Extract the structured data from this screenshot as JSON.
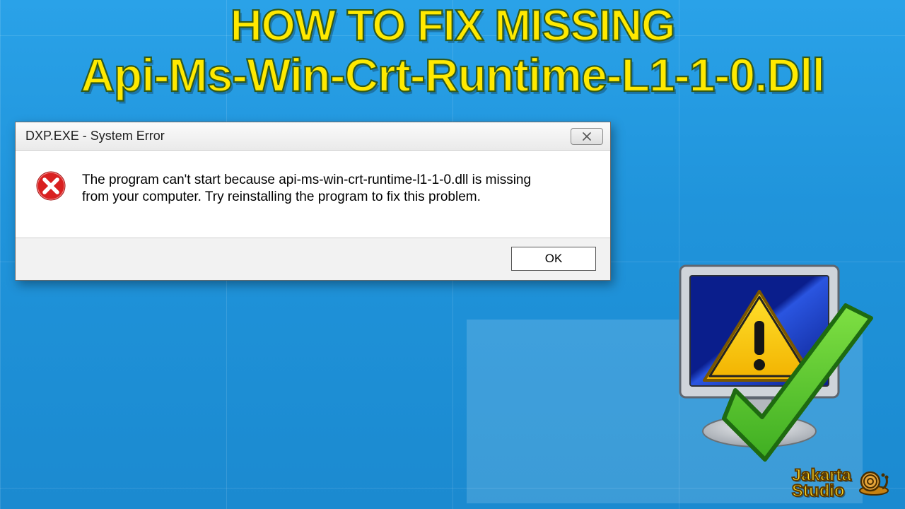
{
  "headline": {
    "line1": "HOW TO FIX MISSING",
    "line2": "Api-Ms-Win-Crt-Runtime-L1-1-0.Dll"
  },
  "dialog": {
    "title": "DXP.EXE - System Error",
    "close_glyph": "✕",
    "message": "The program can't start because api-ms-win-crt-runtime-l1-1-0.dll is missing from your computer. Try reinstalling the program to fix this problem.",
    "ok_label": "OK"
  },
  "brand": {
    "name": "Jakarta\nStudio"
  }
}
